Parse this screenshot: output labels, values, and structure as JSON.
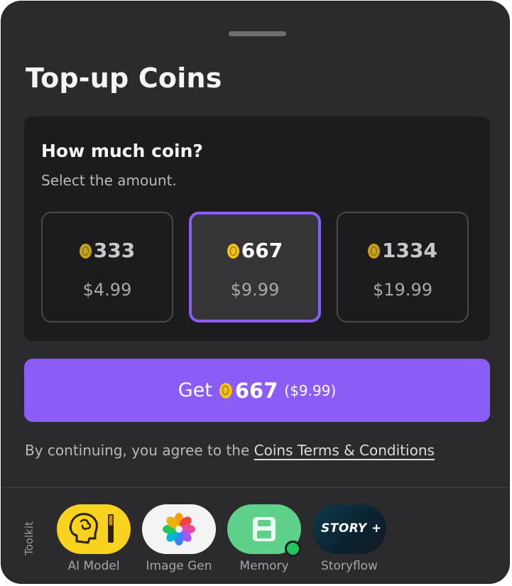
{
  "sheet": {
    "title": "Top-up Coins"
  },
  "amount_card": {
    "question": "How much coin?",
    "subtitle": "Select the amount.",
    "options": [
      {
        "coins": "333",
        "price": "$4.99",
        "selected": false
      },
      {
        "coins": "667",
        "price": "$9.99",
        "selected": true
      },
      {
        "coins": "1334",
        "price": "$19.99",
        "selected": false
      }
    ]
  },
  "cta": {
    "get_label": "Get",
    "amount": "667",
    "price": "($9.99)"
  },
  "terms": {
    "prefix": "By continuing, you agree to the ",
    "link": "Coins Terms & Conditions"
  },
  "toolkit": {
    "label": "Toolkit",
    "items": [
      {
        "label": "AI Model",
        "icon": "brain-icon"
      },
      {
        "label": "Image Gen",
        "icon": "flower-icon"
      },
      {
        "label": "Memory",
        "icon": "floppy-disk-icon"
      },
      {
        "label": "Storyflow",
        "icon": "story-plus-logo",
        "logo_text": "STORY +"
      }
    ]
  },
  "colors": {
    "accent": "#8b5cf6",
    "background": "#2b2b2d",
    "card": "#1c1c1e",
    "coin": "#f3c21a",
    "status_online": "#22c55e"
  }
}
